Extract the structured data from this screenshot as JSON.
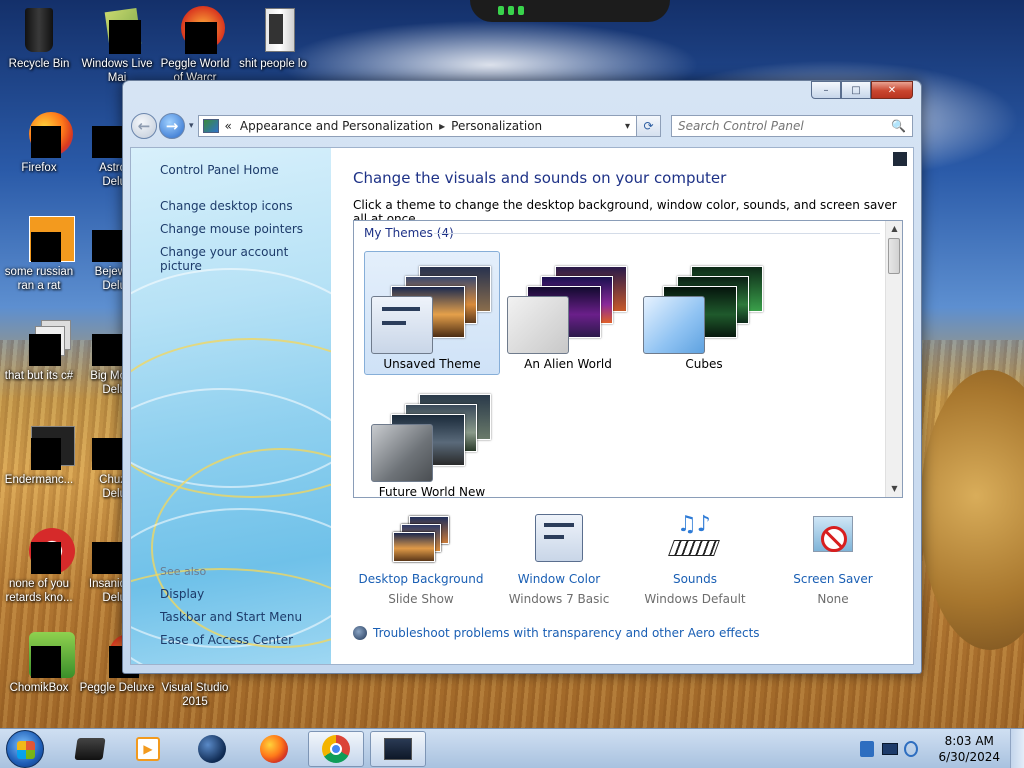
{
  "desktop": {
    "icons": [
      {
        "label": "Recycle Bin",
        "icon": "recycle-bin-icon"
      },
      {
        "label": "Windows Live Mai",
        "icon": "windows-live-mail-icon"
      },
      {
        "label": "Peggle World of Warcr",
        "icon": "peggle-world-icon"
      },
      {
        "label": "shit people lo",
        "icon": "folder-icon"
      },
      {
        "label": "Firefox",
        "icon": "firefox-icon"
      },
      {
        "label": "Astro Delu",
        "icon": "game-icon"
      },
      {
        "label": "some russian ran a rat",
        "icon": "file-icon"
      },
      {
        "label": "Bejew Delu",
        "icon": "game-icon"
      },
      {
        "label": "that but its c#",
        "icon": "document-stack-icon"
      },
      {
        "label": "Big Mo Delu",
        "icon": "game-icon"
      },
      {
        "label": "Endermanc...",
        "icon": "app-icon"
      },
      {
        "label": "Chuz Delu",
        "icon": "game-icon"
      },
      {
        "label": "none of you retards kno...",
        "icon": "app-icon"
      },
      {
        "label": "Insaniq Delu",
        "icon": "game-icon"
      },
      {
        "label": "ChomikBox",
        "icon": "chomikbox-icon"
      },
      {
        "label": "Peggle Deluxe",
        "icon": "peggle-icon"
      },
      {
        "label": "Visual Studio 2015",
        "icon": "visual-studio-icon"
      }
    ]
  },
  "window": {
    "caption_buttons": {
      "minimize": "–",
      "maximize": "□",
      "close": "✕"
    },
    "nav": {
      "back": "←",
      "forward": "→",
      "dropdown": "▾",
      "breadcrumb_prefix": "«",
      "breadcrumb_1": "Appearance and Personalization",
      "breadcrumb_sep": "▸",
      "breadcrumb_2": "Personalization",
      "address_dropdown": "▾",
      "refresh": "⟳"
    },
    "search": {
      "placeholder": "Search Control Panel",
      "icon": "🔍"
    },
    "left_pane": {
      "links": [
        "Control Panel Home",
        "Change desktop icons",
        "Change mouse pointers",
        "Change your account picture"
      ],
      "see_also_heading": "See also",
      "see_also": [
        "Display",
        "Taskbar and Start Menu",
        "Ease of Access Center"
      ]
    },
    "main": {
      "title": "Change the visuals and sounds on your computer",
      "subtitle": "Click a theme to change the desktop background, window color, sounds, and screen saver all at once.",
      "themes_heading": "My Themes (4)",
      "themes": [
        {
          "name": "Unsaved Theme",
          "selected": true
        },
        {
          "name": "An Alien World",
          "selected": false
        },
        {
          "name": "Cubes",
          "selected": false
        },
        {
          "name": "Future World New",
          "selected": false
        }
      ],
      "scroll_up": "▲",
      "scroll_down": "▼",
      "settings": [
        {
          "label": "Desktop Background",
          "value": "Slide Show",
          "icon": "desktop-background-icon"
        },
        {
          "label": "Window Color",
          "value": "Windows 7 Basic",
          "icon": "window-color-icon"
        },
        {
          "label": "Sounds",
          "value": "Windows Default",
          "icon": "sounds-icon"
        },
        {
          "label": "Screen Saver",
          "value": "None",
          "icon": "screen-saver-icon"
        }
      ],
      "troubleshoot_link": "Troubleshoot problems with transparency and other Aero effects"
    }
  },
  "taskbar": {
    "pinned": [
      {
        "icon": "media-center-icon"
      },
      {
        "icon": "media-player-icon"
      },
      {
        "icon": "globe-icon"
      },
      {
        "icon": "firefox-icon"
      },
      {
        "icon": "chrome-icon",
        "active": true
      },
      {
        "icon": "control-panel-icon",
        "active": true
      }
    ],
    "tray": {
      "time": "8:03 AM",
      "date": "6/30/2024"
    }
  }
}
